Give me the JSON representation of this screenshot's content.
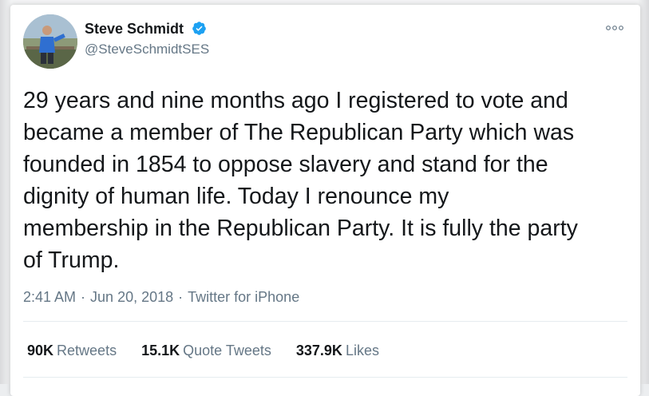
{
  "user": {
    "name": "Steve Schmidt",
    "handle": "@SteveSchmidtSES",
    "verified": true
  },
  "tweet": {
    "lines": [
      "29 years and nine months ago I registered to vote and",
      "became a member of The Republican Party which was",
      "founded in 1854 to oppose slavery and stand for the",
      "dignity of human life. Today I renounce my",
      "membership in the Republican Party. It is fully the party",
      "of Trump."
    ],
    "time": "2:41 AM",
    "date": "Jun 20, 2018",
    "source": "Twitter for iPhone",
    "separator": "·"
  },
  "stats": {
    "retweets_count": "90K",
    "retweets_label": "Retweets",
    "quotes_count": "15.1K",
    "quotes_label": "Quote Tweets",
    "likes_count": "337.9K",
    "likes_label": "Likes"
  },
  "icons": {
    "verified": "verified-badge-icon",
    "more": "more-options-icon"
  },
  "colors": {
    "text": "#14171a",
    "secondary": "#657786",
    "verified": "#1da1f2",
    "divider": "#e6ecf0"
  }
}
